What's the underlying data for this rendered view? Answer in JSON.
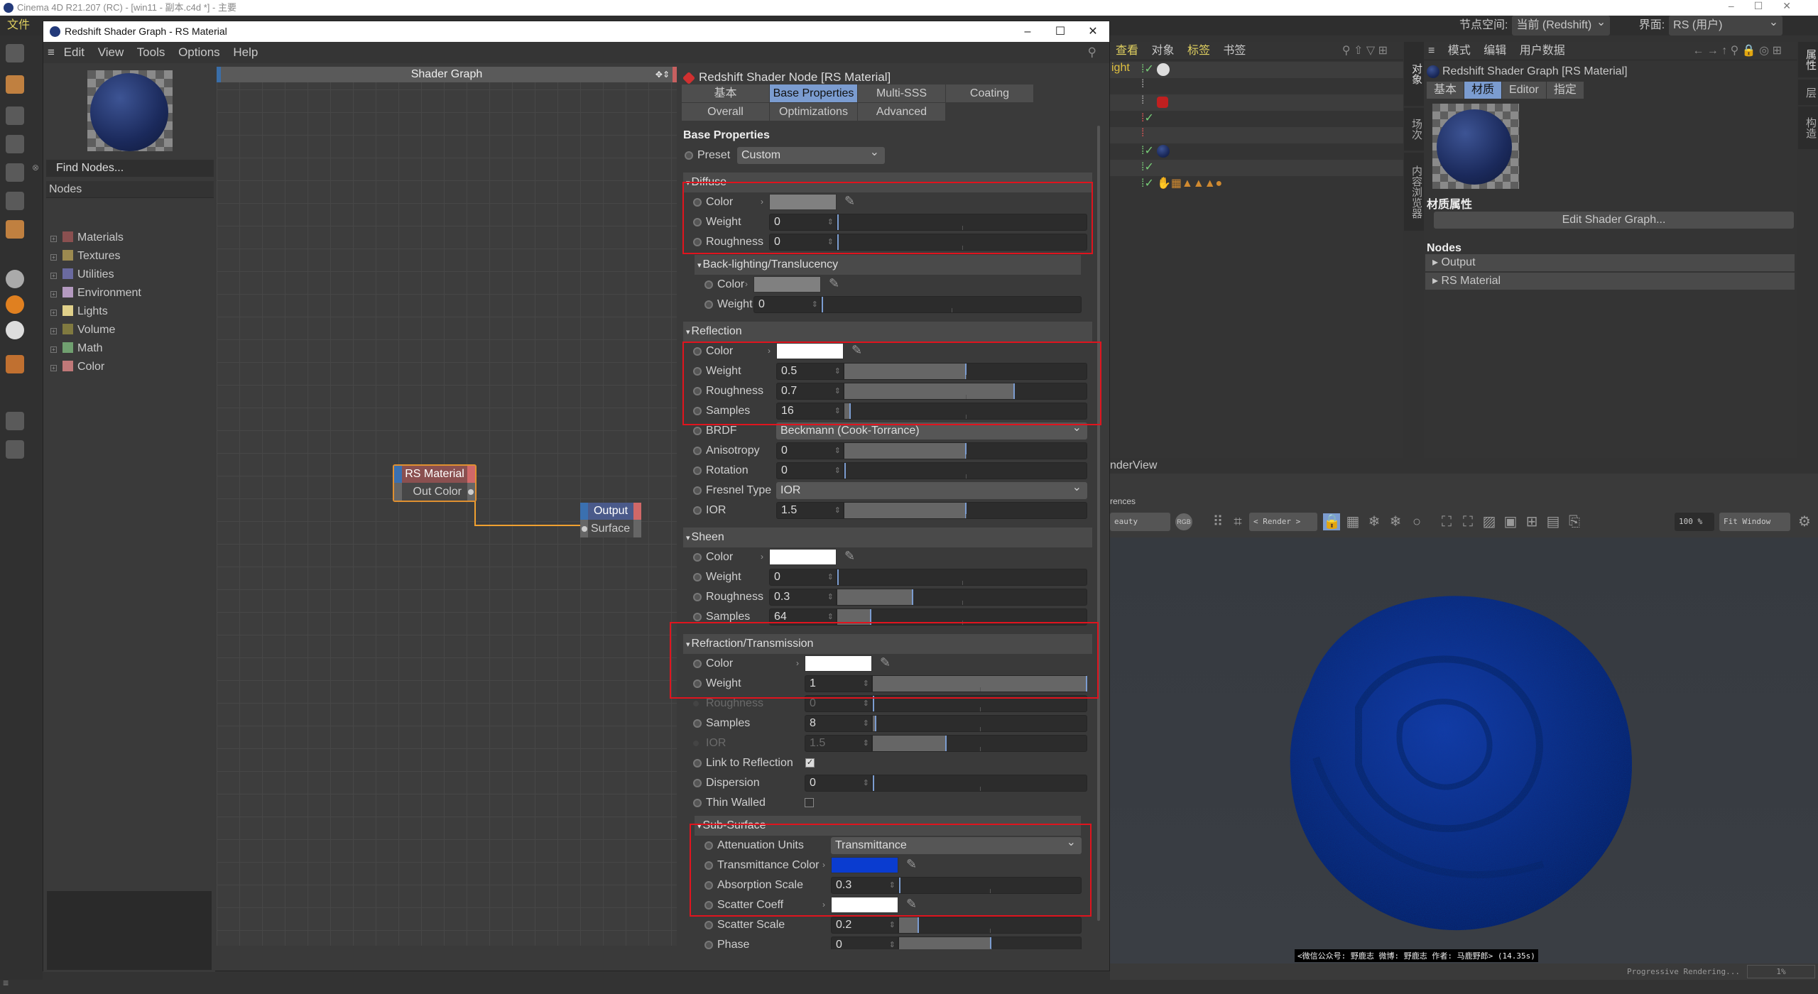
{
  "os_title": "Cinema 4D R21.207 (RC) - [win11 - 副本.c4d *] - 主要",
  "main_menu": {
    "first": "文件",
    "node_space_label": "节点空间:",
    "node_space_value": "当前 (Redshift)",
    "interface_label": "界面:",
    "interface_value": "RS (用户)"
  },
  "window": {
    "title": "Redshift Shader Graph - RS Material",
    "controls": {
      "minimize": "–",
      "maximize": "☐",
      "close": "✕"
    },
    "menu": [
      "Edit",
      "View",
      "Tools",
      "Options",
      "Help"
    ]
  },
  "node_browser": {
    "find_placeholder": "Find Nodes...",
    "header": "Nodes",
    "categories": [
      {
        "label": "Materials",
        "color": "#8a5050"
      },
      {
        "label": "Textures",
        "color": "#9c8a50"
      },
      {
        "label": "Utilities",
        "color": "#6a6aa0"
      },
      {
        "label": "Environment",
        "color": "#b49ac0"
      },
      {
        "label": "Lights",
        "color": "#e0d08a"
      },
      {
        "label": "Volume",
        "color": "#807a40"
      },
      {
        "label": "Math",
        "color": "#70a070"
      },
      {
        "label": "Color",
        "color": "#c07878"
      }
    ]
  },
  "graph": {
    "title": "Shader Graph",
    "nodes": {
      "rs_material": {
        "title": "RS Material",
        "port": "Out Color"
      },
      "output": {
        "title": "Output",
        "port": "Surface"
      }
    },
    "wire_color": "#f0a030"
  },
  "props": {
    "title": "Redshift Shader Node [RS Material]",
    "tabs_row1": [
      "基本",
      "Base Properties",
      "Multi-SSS",
      "Coating"
    ],
    "tabs_row2": [
      "Overall",
      "Optimizations",
      "Advanced"
    ],
    "active_tab": "Base Properties",
    "heading": "Base Properties",
    "preset": {
      "label": "Preset",
      "value": "Custom"
    },
    "sections": [
      {
        "id": "diffuse",
        "title": "Diffuse",
        "highlighted": true,
        "rows": [
          {
            "label": "Color",
            "type": "color",
            "value": "#808080"
          },
          {
            "label": "Weight",
            "type": "number",
            "value": "0",
            "level": 0
          },
          {
            "label": "Roughness",
            "type": "number",
            "value": "0",
            "level": 0
          }
        ]
      },
      {
        "id": "backlight",
        "title": "Back-lighting/Translucency",
        "rows": [
          {
            "label": "Color",
            "type": "color",
            "value": "#808080"
          },
          {
            "label": "Weight",
            "type": "number",
            "value": "0",
            "level": 0
          }
        ]
      },
      {
        "id": "reflection",
        "title": "Reflection",
        "rows": [
          {
            "label": "Color",
            "type": "color",
            "value": "#ffffff"
          },
          {
            "label": "Weight",
            "type": "number",
            "value": "0.5",
            "level": 0.5
          },
          {
            "label": "Roughness",
            "type": "number",
            "value": "0.7",
            "level": 0.7
          },
          {
            "label": "Samples",
            "type": "number",
            "value": "16",
            "level": 0.02
          },
          {
            "label": "BRDF",
            "type": "dropdown",
            "value": "Beckmann (Cook-Torrance)"
          },
          {
            "label": "Anisotropy",
            "type": "number",
            "value": "0",
            "level": 0.5
          },
          {
            "label": "Rotation",
            "type": "number",
            "value": "0",
            "level": 0
          },
          {
            "label": "Fresnel Type",
            "type": "dropdown",
            "value": "IOR"
          },
          {
            "label": "IOR",
            "type": "number",
            "value": "1.5",
            "level": 0.5
          }
        ]
      },
      {
        "id": "sheen",
        "title": "Sheen",
        "rows": [
          {
            "label": "Color",
            "type": "color",
            "value": "#ffffff"
          },
          {
            "label": "Weight",
            "type": "number",
            "value": "0",
            "level": 0
          },
          {
            "label": "Roughness",
            "type": "number",
            "value": "0.3",
            "level": 0.3
          },
          {
            "label": "Samples",
            "type": "number",
            "value": "64",
            "level": 0.13
          }
        ]
      },
      {
        "id": "refraction",
        "title": "Refraction/Transmission",
        "rows": [
          {
            "label": "Color",
            "type": "color",
            "value": "#ffffff"
          },
          {
            "label": "Weight",
            "type": "number",
            "value": "1",
            "level": 1
          },
          {
            "label": "Roughness",
            "type": "number",
            "value": "0",
            "level": 0,
            "disabled": true
          },
          {
            "label": "Samples",
            "type": "number",
            "value": "8",
            "level": 0.01
          },
          {
            "label": "IOR",
            "type": "number",
            "value": "1.5",
            "level": 0.34,
            "disabled": true
          },
          {
            "label": "Link to Reflection",
            "type": "checkbox",
            "checked": true
          },
          {
            "label": "Dispersion",
            "type": "number",
            "value": "0",
            "level": 0
          },
          {
            "label": "Thin Walled",
            "type": "checkbox",
            "checked": false
          }
        ]
      },
      {
        "id": "subsurface",
        "title": "Sub-Surface",
        "rows": [
          {
            "label": "Attenuation Units",
            "type": "dropdown",
            "value": "Transmittance"
          },
          {
            "label": "Transmittance Color",
            "type": "color",
            "value": "#0a3cd0"
          },
          {
            "label": "Absorption Scale",
            "type": "number",
            "value": "0.3",
            "level": 0
          },
          {
            "label": "Scatter Coeff",
            "type": "color",
            "value": "#ffffff"
          },
          {
            "label": "Scatter Scale",
            "type": "number",
            "value": "0.2",
            "level": 0.1
          },
          {
            "label": "Phase",
            "type": "number",
            "value": "0",
            "level": 0.5
          }
        ]
      }
    ]
  },
  "object_manager": {
    "menu": [
      "查看",
      "对象",
      "标签",
      "书签"
    ],
    "first_row_label": "ight"
  },
  "middle_tabs": [
    "对象",
    "场次",
    "内容浏览器"
  ],
  "right_tabs": [
    "属性",
    "层",
    "构造"
  ],
  "attributes": {
    "menu": [
      "模式",
      "编辑",
      "用户数据"
    ],
    "title": "Redshift Shader Graph [RS Material]",
    "tabs": [
      "基本",
      "材质",
      "Editor",
      "指定"
    ],
    "active_tab": "材质",
    "section": "材质属性",
    "edit_button": "Edit Shader Graph...",
    "nodes_header": "Nodes",
    "nodes": [
      "Output",
      "RS Material"
    ]
  },
  "render_view": {
    "title": "nderView",
    "sub_label": "rences",
    "aov": "eauty",
    "rgb": "RGB",
    "camera": "< Render >",
    "zoom": "100 %",
    "fit": "Fit Window",
    "caption": "<微信公众号: 野鹿志  微博: 野鹿志  作者: 马鹿野郎> (14.35s)",
    "status": "Progressive Rendering...",
    "progress": "1%",
    "object_color": "#1a3aa8"
  }
}
